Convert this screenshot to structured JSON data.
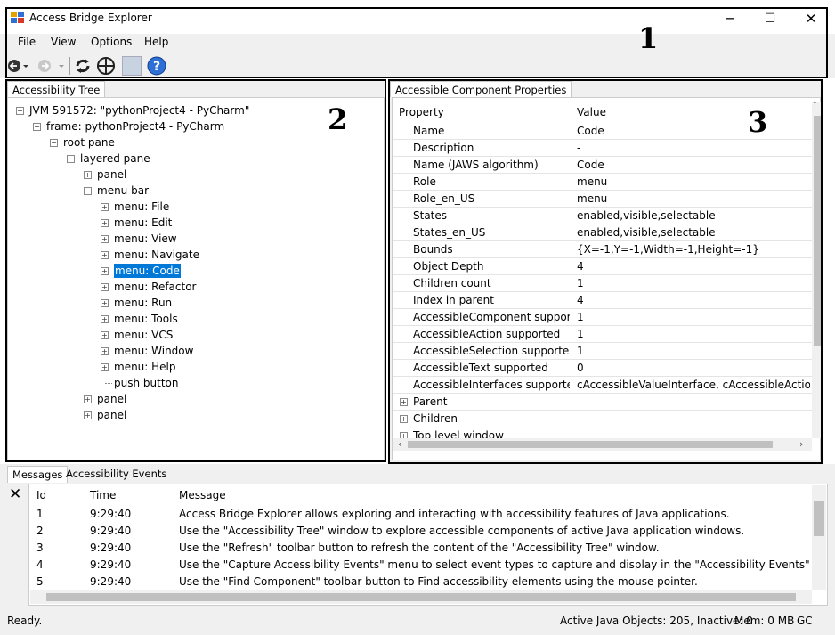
{
  "window": {
    "title": "Access Bridge Explorer",
    "minimize": "─",
    "maximize": "☐",
    "close": "✕"
  },
  "menu": [
    "File",
    "View",
    "Options",
    "Help"
  ],
  "annotations": [
    "1",
    "2",
    "3"
  ],
  "tree_tab": "Accessibility Tree",
  "tree": [
    {
      "label": "JVM 591572: \"pythonProject4 - PyCharm\"",
      "level": 0,
      "exp": "-"
    },
    {
      "label": "frame: pythonProject4 - PyCharm",
      "level": 1,
      "exp": "-"
    },
    {
      "label": "root pane",
      "level": 2,
      "exp": "-"
    },
    {
      "label": "layered pane",
      "level": 3,
      "exp": "-"
    },
    {
      "label": "panel",
      "level": 4,
      "exp": "+"
    },
    {
      "label": "menu bar",
      "level": 4,
      "exp": "-"
    },
    {
      "label": "menu: File",
      "level": 5,
      "exp": "+"
    },
    {
      "label": "menu: Edit",
      "level": 5,
      "exp": "+"
    },
    {
      "label": "menu: View",
      "level": 5,
      "exp": "+"
    },
    {
      "label": "menu: Navigate",
      "level": 5,
      "exp": "+"
    },
    {
      "label": "menu: Code",
      "level": 5,
      "exp": "+",
      "selected": true
    },
    {
      "label": "menu: Refactor",
      "level": 5,
      "exp": "+"
    },
    {
      "label": "menu: Run",
      "level": 5,
      "exp": "+"
    },
    {
      "label": "menu: Tools",
      "level": 5,
      "exp": "+"
    },
    {
      "label": "menu: VCS",
      "level": 5,
      "exp": "+"
    },
    {
      "label": "menu: Window",
      "level": 5,
      "exp": "+"
    },
    {
      "label": "menu: Help",
      "level": 5,
      "exp": "+"
    },
    {
      "label": "push button",
      "level": 5,
      "exp": ""
    },
    {
      "label": "panel",
      "level": 4,
      "exp": "+"
    },
    {
      "label": "panel",
      "level": 4,
      "exp": "+"
    }
  ],
  "props_tab": "Accessible Component Properties",
  "props_header": {
    "property": "Property",
    "value": "Value"
  },
  "props": [
    {
      "p": "Name",
      "v": "Code"
    },
    {
      "p": "Description",
      "v": "-"
    },
    {
      "p": "Name (JAWS algorithm)",
      "v": "Code"
    },
    {
      "p": "Role",
      "v": "menu"
    },
    {
      "p": "Role_en_US",
      "v": "menu"
    },
    {
      "p": "States",
      "v": "enabled,visible,selectable"
    },
    {
      "p": "States_en_US",
      "v": "enabled,visible,selectable"
    },
    {
      "p": "Bounds",
      "v": "{X=-1,Y=-1,Width=-1,Height=-1}"
    },
    {
      "p": "Object Depth",
      "v": "4"
    },
    {
      "p": "Children count",
      "v": "1"
    },
    {
      "p": "Index in parent",
      "v": "4"
    },
    {
      "p": "AccessibleComponent suppor...",
      "v": "1"
    },
    {
      "p": "AccessibleAction supported",
      "v": "1"
    },
    {
      "p": "AccessibleSelection supported",
      "v": "1"
    },
    {
      "p": "AccessibleText supported",
      "v": "0"
    },
    {
      "p": "AccessibleInterfaces supported",
      "v": "cAccessibleValueInterface, cAccessibleActionInt"
    },
    {
      "p": "Parent",
      "v": "",
      "group": true
    },
    {
      "p": "Children",
      "v": "",
      "group": true
    },
    {
      "p": "Top level window",
      "v": "",
      "group": true
    }
  ],
  "bottom_tabs": [
    "Messages",
    "Accessibility Events"
  ],
  "messages_header": {
    "id": "Id",
    "time": "Time",
    "message": "Message"
  },
  "messages": [
    {
      "id": "1",
      "time": "9:29:40",
      "message": "Access Bridge Explorer allows exploring and interacting with accessibility features of Java applications."
    },
    {
      "id": "2",
      "time": "9:29:40",
      "message": "Use the \"Accessibility Tree\" window to explore accessible components of active Java application windows."
    },
    {
      "id": "3",
      "time": "9:29:40",
      "message": "Use the \"Refresh\" toolbar button to refresh the content of the \"Accessibility Tree\" window."
    },
    {
      "id": "4",
      "time": "9:29:40",
      "message": "Use the \"Capture Accessibility Events\" menu to select event types to capture and display in the \"Accessibility Events\" window."
    },
    {
      "id": "5",
      "time": "9:29:40",
      "message": "Use the \"Find Component\" toolbar button to Find accessibility elements using the mouse pointer."
    }
  ],
  "status": {
    "left": "Ready.",
    "objects": "Active Java Objects: 205, Inactive: 0",
    "mem": "Mem: 0 MB",
    "gc": "GC"
  },
  "colors": {
    "selection": "#0078d7",
    "chrome": "#f0f0f0"
  }
}
